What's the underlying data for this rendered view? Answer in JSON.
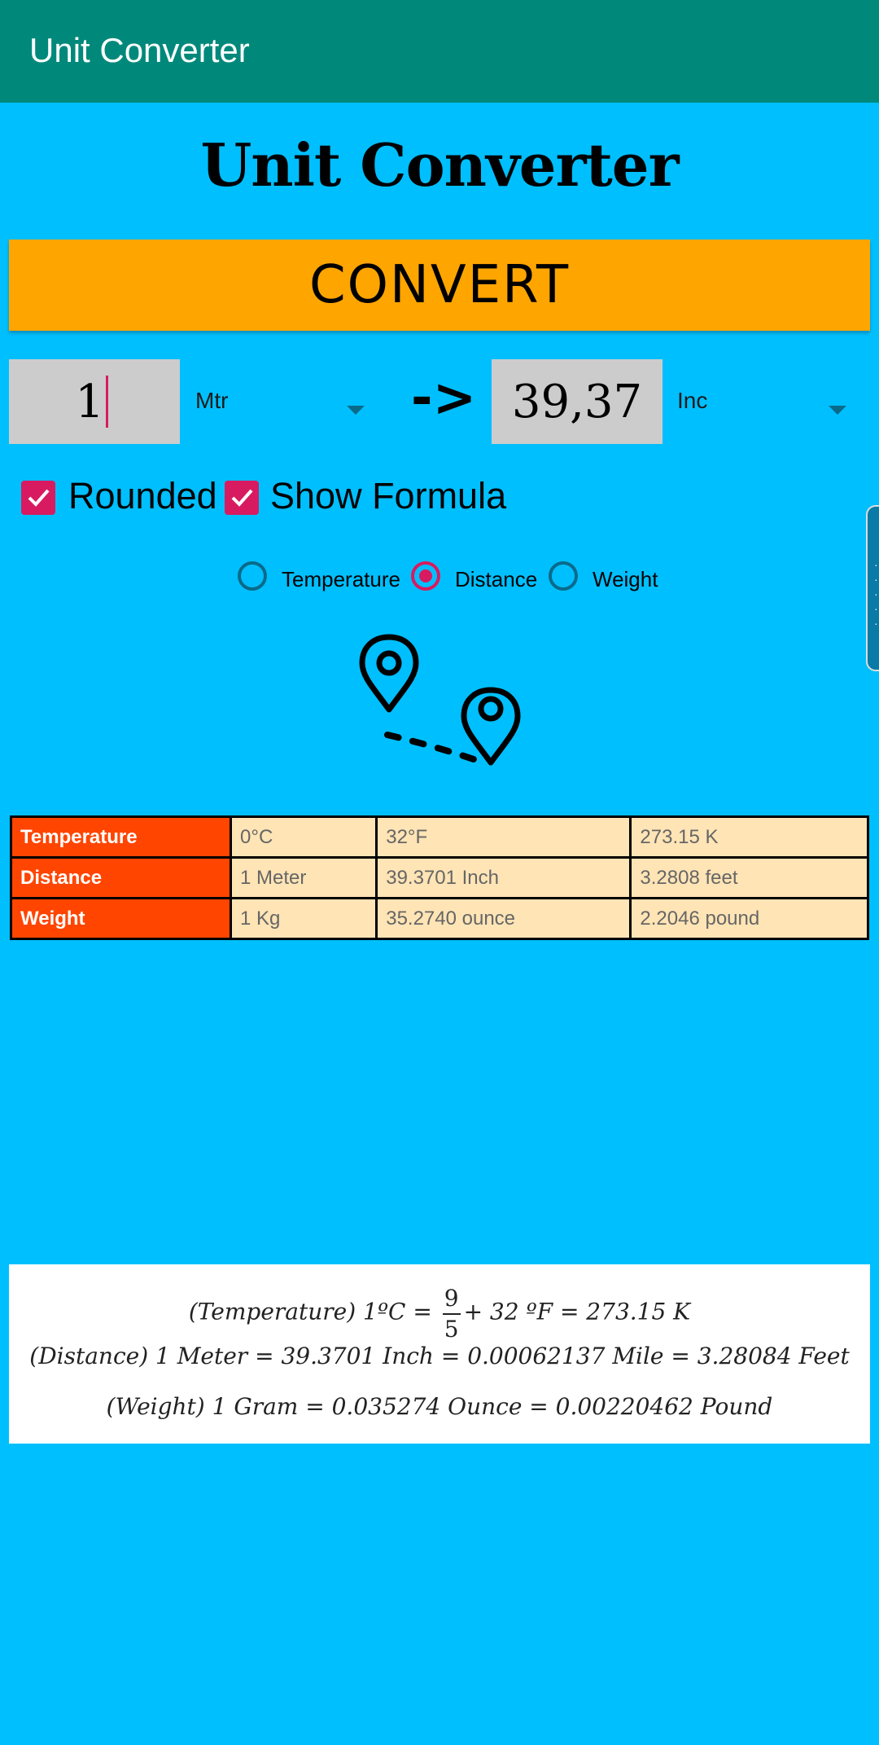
{
  "appbar": {
    "title": "Unit Converter"
  },
  "heading": "Unit Converter",
  "convert_button": "CONVERT",
  "input": {
    "value": "1",
    "unit": "Mtr"
  },
  "arrow_sign": "->",
  "output": {
    "value": "39,37",
    "unit": "Inc"
  },
  "options": {
    "rounded": {
      "label": "Rounded",
      "checked": true
    },
    "show_formula": {
      "label": "Show Formula",
      "checked": true
    }
  },
  "categories": [
    {
      "label": "Temperature",
      "selected": false
    },
    {
      "label": "Distance",
      "selected": true
    },
    {
      "label": "Weight",
      "selected": false
    }
  ],
  "table": {
    "rows": [
      {
        "name": "Temperature",
        "values": [
          "0°C",
          "32°F",
          "273.15 K"
        ]
      },
      {
        "name": "Distance",
        "values": [
          "1 Meter",
          "39.3701 Inch",
          "3.2808 feet"
        ]
      },
      {
        "name": "Weight",
        "values": [
          "1 Kg",
          "35.2740 ounce",
          "2.2046 pound"
        ]
      }
    ]
  },
  "formulas": {
    "temperature_left": "(Temperature)  1ºC = ",
    "temperature_num": "9",
    "temperature_den": "5",
    "temperature_right": "+ 32 ºF = 273.15 K",
    "distance": "(Distance) 1 Meter = 39.3701 Inch = 0.00062137 Mile =  3.28084 Feet",
    "weight": "(Weight) 1 Gram = 0.035274 Ounce = 0.00220462 Pound"
  },
  "colors": {
    "background": "#00BFFF",
    "appbar": "#00897B",
    "convert_button": "#FFA500",
    "accent": "#D81B60",
    "table_header": "#FF4500",
    "table_cell": "#FFE4B5"
  },
  "icons": {
    "illustration": "map-route-pins-icon"
  }
}
